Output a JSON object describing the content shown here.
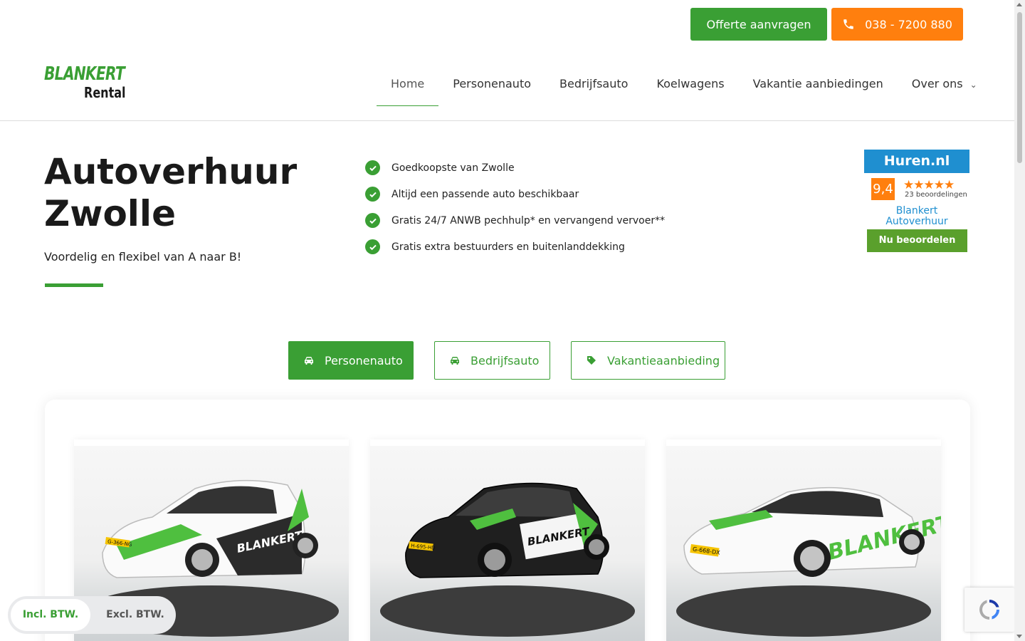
{
  "topbar": {
    "quote_label": "Offerte aanvragen",
    "phone_label": "038 - 7200 880",
    "quote_color": "#3a9f34",
    "phone_color": "#ff7f0e"
  },
  "logo": {
    "line1": "BLANKERT",
    "line2": "Rental"
  },
  "nav": {
    "items": [
      {
        "label": "Home",
        "active": true
      },
      {
        "label": "Personenauto"
      },
      {
        "label": "Bedrijfsauto"
      },
      {
        "label": "Koelwagens"
      },
      {
        "label": "Vakantie aanbiedingen"
      },
      {
        "label": "Over ons",
        "has_dropdown": true
      }
    ]
  },
  "hero": {
    "title_line1": "Autoverhuur",
    "title_line2": "Zwolle",
    "subtitle": "Voordelig en flexibel van A naar B!"
  },
  "usps": [
    "Goedkoopste van Zwolle",
    "Altijd een passende auto beschikbaar",
    "Gratis 24/7 ANWB pechhulp* en vervangend vervoer**",
    "Gratis extra bestuurders en buitenlanddekking"
  ],
  "huren_widget": {
    "brand": "Huren.nl",
    "score": "9,4",
    "stars": 5,
    "review_count": "23 beoordelingen",
    "company_line1": "Blankert",
    "company_line2": "Autoverhuur",
    "button_label": "Nu beoordelen"
  },
  "category_tabs": [
    {
      "label": "Personenauto",
      "icon": "car-icon",
      "active": true
    },
    {
      "label": "Bedrijfsauto",
      "icon": "car-icon"
    },
    {
      "label": "Vakantieaanbieding",
      "icon": "tag-icon"
    }
  ],
  "cars": [
    {
      "name": "car-white-hatchback",
      "plate": "G-366-NG",
      "body_color": "#ffffff"
    },
    {
      "name": "car-black-city",
      "plate": "H-695-HD",
      "body_color": "#1f1f1f"
    },
    {
      "name": "car-white-sedan",
      "plate": "G-668-DX",
      "body_color": "#ffffff"
    }
  ],
  "vat_toggle": {
    "incl_label": "Incl. BTW.",
    "excl_label": "Excl. BTW.",
    "selected": "incl"
  },
  "colors": {
    "brand_green": "#3a9f34",
    "accent_orange": "#ff7f0e",
    "huren_blue": "#1f8fd0"
  }
}
